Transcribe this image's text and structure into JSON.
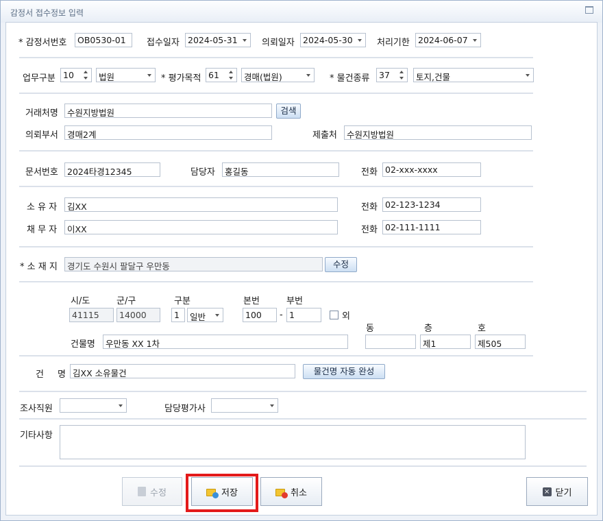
{
  "window": {
    "title": "감정서 접수정보 입력"
  },
  "row1": {
    "appraisal_no_label": "* 감정서번호",
    "appraisal_no": "OB0530-01",
    "receipt_date_label": "접수일자",
    "receipt_date": "2024-05-31",
    "request_date_label": "의뢰일자",
    "request_date": "2024-05-30",
    "deadline_label": "처리기한",
    "deadline": "2024-06-07"
  },
  "row2": {
    "business_type_label": "업무구분",
    "business_type_code": "10",
    "business_type": "법원",
    "purpose_label": "* 평가목적",
    "purpose_code": "61",
    "purpose": "경매(법원)",
    "property_type_label": "* 물건종류",
    "property_type_code": "37",
    "property_type": "토지,건물"
  },
  "client": {
    "client_label": "거래처명",
    "client": "수원지방법원",
    "search_button": "검색",
    "dept_label": "의뢰부서",
    "dept": "경매2계",
    "submit_to_label": "제출처",
    "submit_to": "수원지방법원"
  },
  "doc": {
    "doc_no_label": "문서번호",
    "doc_no": "2024타경12345",
    "manager_label": "담당자",
    "manager": "홍길동",
    "phone_label": "전화",
    "phone": "02-xxx-xxxx"
  },
  "parties": {
    "owner_label": "소 유 자",
    "owner": "김XX",
    "owner_phone_label": "전화",
    "owner_phone": "02-123-1234",
    "debtor_label": "채 무 자",
    "debtor": "이XX",
    "debtor_phone_label": "전화",
    "debtor_phone": "02-111-1111"
  },
  "location": {
    "address_label": "* 소 재 지",
    "address": "경기도 수원시 팔달구 우만동",
    "edit_button": "수정",
    "sido_label": "시/도",
    "sido": "41115",
    "gugun_label": "군/구",
    "gugun": "14000",
    "type_label": "구분",
    "type_code": "1",
    "type": "일반",
    "main_no_label": "본번",
    "main_no": "100",
    "dash": "-",
    "sub_no_label": "부번",
    "sub_no": "1",
    "other_label": "외",
    "dong_label": "동",
    "dong": "",
    "floor_label": "층",
    "floor": "제1",
    "ho_label": "호",
    "ho": "제505",
    "building_label": "건물명",
    "building": "우만동 XX 1차"
  },
  "case": {
    "name_label_1": "건",
    "name_label_2": "명",
    "name": "김XX 소유물건",
    "autofill_button": "물건명 자동 완성"
  },
  "staff": {
    "investigator_label": "조사직원",
    "investigator": "",
    "appraiser_label": "담당평가사",
    "appraiser": ""
  },
  "notes": {
    "label": "기타사항",
    "value": ""
  },
  "buttons": {
    "edit": "수정",
    "save": "저장",
    "cancel": "취소",
    "close": "닫기"
  },
  "colors": {
    "highlight": "#e31a1a",
    "folder": "#f3c531",
    "save_badge": "#3a8fd8",
    "cancel_badge": "#e23b2e"
  }
}
